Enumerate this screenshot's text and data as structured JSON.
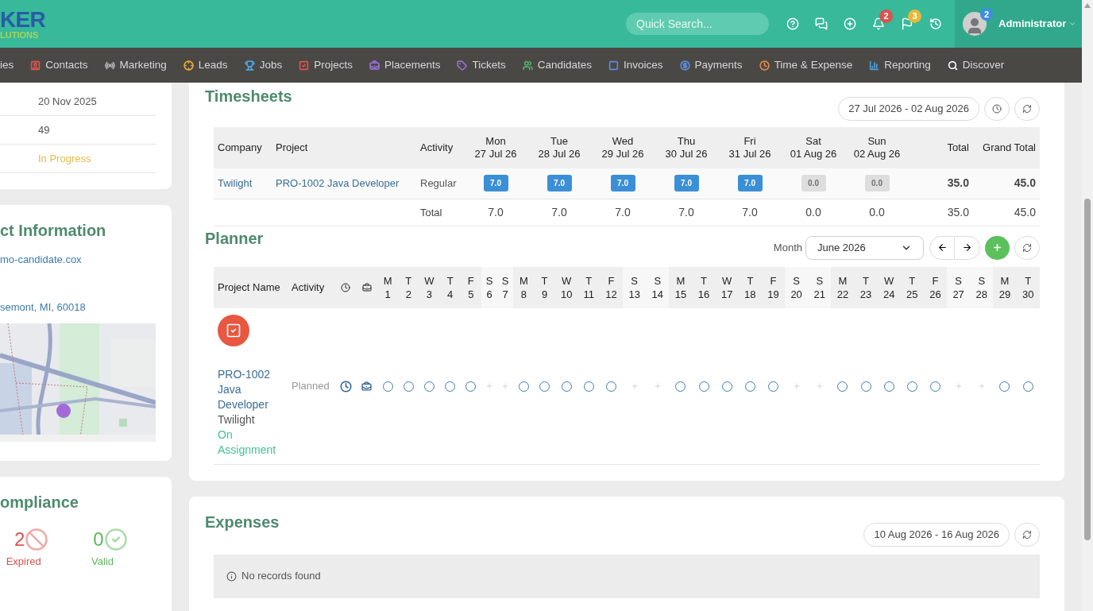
{
  "header": {
    "logo": {
      "main": "KER",
      "sub": "LUTIONS"
    },
    "search": {
      "placeholder": "Quick Search..."
    },
    "bell_badge": "2",
    "flag_badge": "3",
    "user": {
      "name": "Administrator",
      "badge": "2"
    }
  },
  "nav": [
    {
      "label": "ies"
    },
    {
      "label": "Contacts",
      "color": "#e0554c"
    },
    {
      "label": "Marketing",
      "color": "#b5b5b5"
    },
    {
      "label": "Leads",
      "color": "#e8a93a"
    },
    {
      "label": "Jobs",
      "color": "#4aa3df"
    },
    {
      "label": "Projects",
      "color": "#e0554c"
    },
    {
      "label": "Placements",
      "color": "#9b6fd6"
    },
    {
      "label": "Tickets",
      "color": "#9b6fd6"
    },
    {
      "label": "Candidates",
      "color": "#4fb06a"
    },
    {
      "label": "Invoices",
      "color": "#5b8de0"
    },
    {
      "label": "Payments",
      "color": "#5b8de0"
    },
    {
      "label": "Time & Expense",
      "color": "#e58a4a"
    },
    {
      "label": "Reporting",
      "color": "#4aa3df"
    },
    {
      "label": "Discover",
      "color": "#ffffff"
    }
  ],
  "left": {
    "details": [
      {
        "value": "20 Nov 2025",
        "kind": "text"
      },
      {
        "value": "49",
        "kind": "text"
      },
      {
        "value": "In Progress",
        "kind": "status"
      }
    ],
    "contact": {
      "title": "ct Information",
      "email": "mo-candidate.cox",
      "address": "semont, MI, 60018"
    },
    "compliance": {
      "title": "ompliance",
      "items": [
        {
          "count": "2",
          "label": "Expired",
          "kind": "expired"
        },
        {
          "count": "0",
          "label": "Valid",
          "kind": "valid"
        }
      ]
    }
  },
  "timesheets": {
    "title": "Timesheets",
    "range": "27 Jul 2026 - 02 Aug 2026",
    "columns": {
      "company": "Company",
      "project": "Project",
      "activity": "Activity",
      "total": "Total",
      "grand_total": "Grand Total",
      "days": [
        {
          "day": "Mon",
          "date": "27 Jul 26"
        },
        {
          "day": "Tue",
          "date": "28 Jul 26"
        },
        {
          "day": "Wed",
          "date": "29 Jul 26"
        },
        {
          "day": "Thu",
          "date": "30 Jul 26"
        },
        {
          "day": "Fri",
          "date": "31 Jul 26"
        },
        {
          "day": "Sat",
          "date": "01 Aug 26"
        },
        {
          "day": "Sun",
          "date": "02 Aug 26"
        }
      ]
    },
    "rows": [
      {
        "company": "Twilight",
        "project": "PRO-1002 Java Developer",
        "activity": "Regular",
        "total": "35.0",
        "grand_total": "45.0",
        "hours": [
          {
            "value": "7.0",
            "filled": true
          },
          {
            "value": "7.0",
            "filled": true
          },
          {
            "value": "7.0",
            "filled": true
          },
          {
            "value": "7.0",
            "filled": true
          },
          {
            "value": "7.0",
            "filled": true
          },
          {
            "value": "0.0",
            "filled": false
          },
          {
            "value": "0.0",
            "filled": false
          }
        ]
      }
    ],
    "totals": {
      "label": "Total",
      "hours": [
        "7.0",
        "7.0",
        "7.0",
        "7.0",
        "7.0",
        "0.0",
        "0.0"
      ],
      "total": "35.0",
      "grand_total": "45.0"
    }
  },
  "planner": {
    "title": "Planner",
    "month_label": "Month",
    "month": "June 2026",
    "columns": {
      "project": "Project Name",
      "activity": "Activity"
    },
    "days": [
      {
        "letter": "M",
        "number": "1",
        "weekend": false
      },
      {
        "letter": "T",
        "number": "2",
        "weekend": false
      },
      {
        "letter": "W",
        "number": "3",
        "weekend": false
      },
      {
        "letter": "T",
        "number": "4",
        "weekend": false
      },
      {
        "letter": "F",
        "number": "5",
        "weekend": false
      },
      {
        "letter": "S",
        "number": "6",
        "weekend": true
      },
      {
        "letter": "S",
        "number": "7",
        "weekend": true
      },
      {
        "letter": "M",
        "number": "8",
        "weekend": false
      },
      {
        "letter": "T",
        "number": "9",
        "weekend": false
      },
      {
        "letter": "W",
        "number": "10",
        "weekend": false
      },
      {
        "letter": "T",
        "number": "11",
        "weekend": false
      },
      {
        "letter": "F",
        "number": "12",
        "weekend": false
      },
      {
        "letter": "S",
        "number": "13",
        "weekend": true
      },
      {
        "letter": "S",
        "number": "14",
        "weekend": true
      },
      {
        "letter": "M",
        "number": "15",
        "weekend": false
      },
      {
        "letter": "T",
        "number": "16",
        "weekend": false
      },
      {
        "letter": "W",
        "number": "17",
        "weekend": false
      },
      {
        "letter": "T",
        "number": "18",
        "weekend": false
      },
      {
        "letter": "F",
        "number": "19",
        "weekend": false
      },
      {
        "letter": "S",
        "number": "20",
        "weekend": true
      },
      {
        "letter": "S",
        "number": "21",
        "weekend": true
      },
      {
        "letter": "M",
        "number": "22",
        "weekend": false
      },
      {
        "letter": "T",
        "number": "23",
        "weekend": false
      },
      {
        "letter": "W",
        "number": "24",
        "weekend": false
      },
      {
        "letter": "T",
        "number": "25",
        "weekend": false
      },
      {
        "letter": "F",
        "number": "26",
        "weekend": false
      },
      {
        "letter": "S",
        "number": "27",
        "weekend": true
      },
      {
        "letter": "S",
        "number": "28",
        "weekend": true
      },
      {
        "letter": "M",
        "number": "29",
        "weekend": false
      },
      {
        "letter": "T",
        "number": "30",
        "weekend": false
      }
    ],
    "rows": [
      {
        "project": "PRO-1002 Java Developer",
        "company": "Twilight",
        "status": "On Assignment",
        "activity": "Planned"
      }
    ]
  },
  "expenses": {
    "title": "Expenses",
    "range": "10 Aug 2026 - 16 Aug 2026",
    "empty_message": "No records found"
  }
}
